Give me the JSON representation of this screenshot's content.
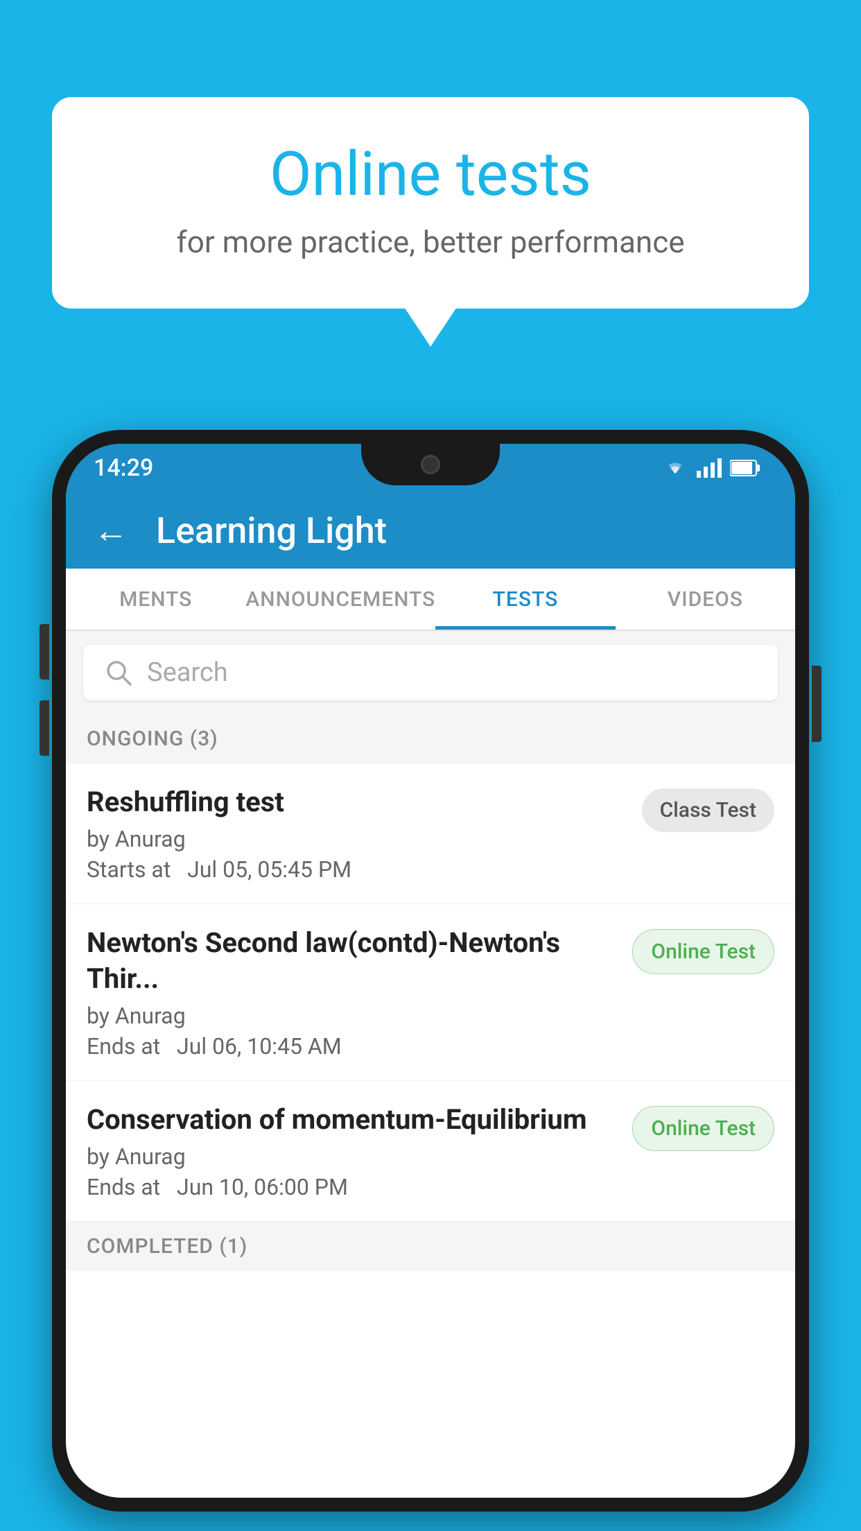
{
  "background_color": "#1ab4e8",
  "bubble": {
    "title": "Online tests",
    "subtitle": "for more practice, better performance"
  },
  "phone": {
    "status_bar": {
      "time": "14:29",
      "icons": [
        "wifi",
        "signal",
        "battery"
      ]
    },
    "app_bar": {
      "title": "Learning Light",
      "back_label": "←"
    },
    "tabs": [
      {
        "label": "MENTS",
        "active": false
      },
      {
        "label": "ANNOUNCEMENTS",
        "active": false
      },
      {
        "label": "TESTS",
        "active": true
      },
      {
        "label": "VIDEOS",
        "active": false
      }
    ],
    "search": {
      "placeholder": "Search"
    },
    "ongoing_section": {
      "label": "ONGOING (3)"
    },
    "tests": [
      {
        "name": "Reshuffling test",
        "author": "by Anurag",
        "date_label": "Starts at",
        "date": "Jul 05, 05:45 PM",
        "badge": "Class Test",
        "badge_type": "class"
      },
      {
        "name": "Newton's Second law(contd)-Newton's Thir...",
        "author": "by Anurag",
        "date_label": "Ends at",
        "date": "Jul 06, 10:45 AM",
        "badge": "Online Test",
        "badge_type": "online"
      },
      {
        "name": "Conservation of momentum-Equilibrium",
        "author": "by Anurag",
        "date_label": "Ends at",
        "date": "Jun 10, 06:00 PM",
        "badge": "Online Test",
        "badge_type": "online"
      }
    ],
    "completed_section": {
      "label": "COMPLETED (1)"
    }
  }
}
